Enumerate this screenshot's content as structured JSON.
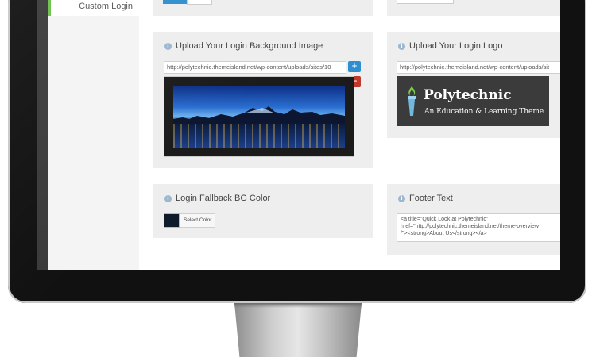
{
  "sidebar": {
    "items": [
      {
        "label": "Custom Login"
      }
    ]
  },
  "panels": {
    "login_background": {
      "title": "Upload Your Login Background Image",
      "url_value": "http://polytechnic.themeisland.net/wp-content/uploads/sites/10",
      "add_icon": "plus-icon",
      "remove_icon": "minus-icon"
    },
    "login_logo": {
      "title": "Upload Your Login Logo",
      "url_value": "http://polytechnic.themeisland.net/wp-content/uploads/sit",
      "logo_name": "Polytechnic",
      "logo_tagline": "An Education & Learning Theme"
    },
    "fallback_color": {
      "title": "Login Fallback BG Color",
      "select_label": "Select Color",
      "color": "#0d1b2a"
    },
    "footer_text": {
      "title": "Footer Text",
      "value": "<a title=\"Quick Look at Polytechnic\"\nhref=\"http://polytechnic.themeisland.net/theme-overview\n/\"><strong>About Us</strong></a>"
    }
  },
  "colors": {
    "accent": "#6cc04a",
    "add_button": "#2e8fd0",
    "remove_button": "#c0392b"
  }
}
